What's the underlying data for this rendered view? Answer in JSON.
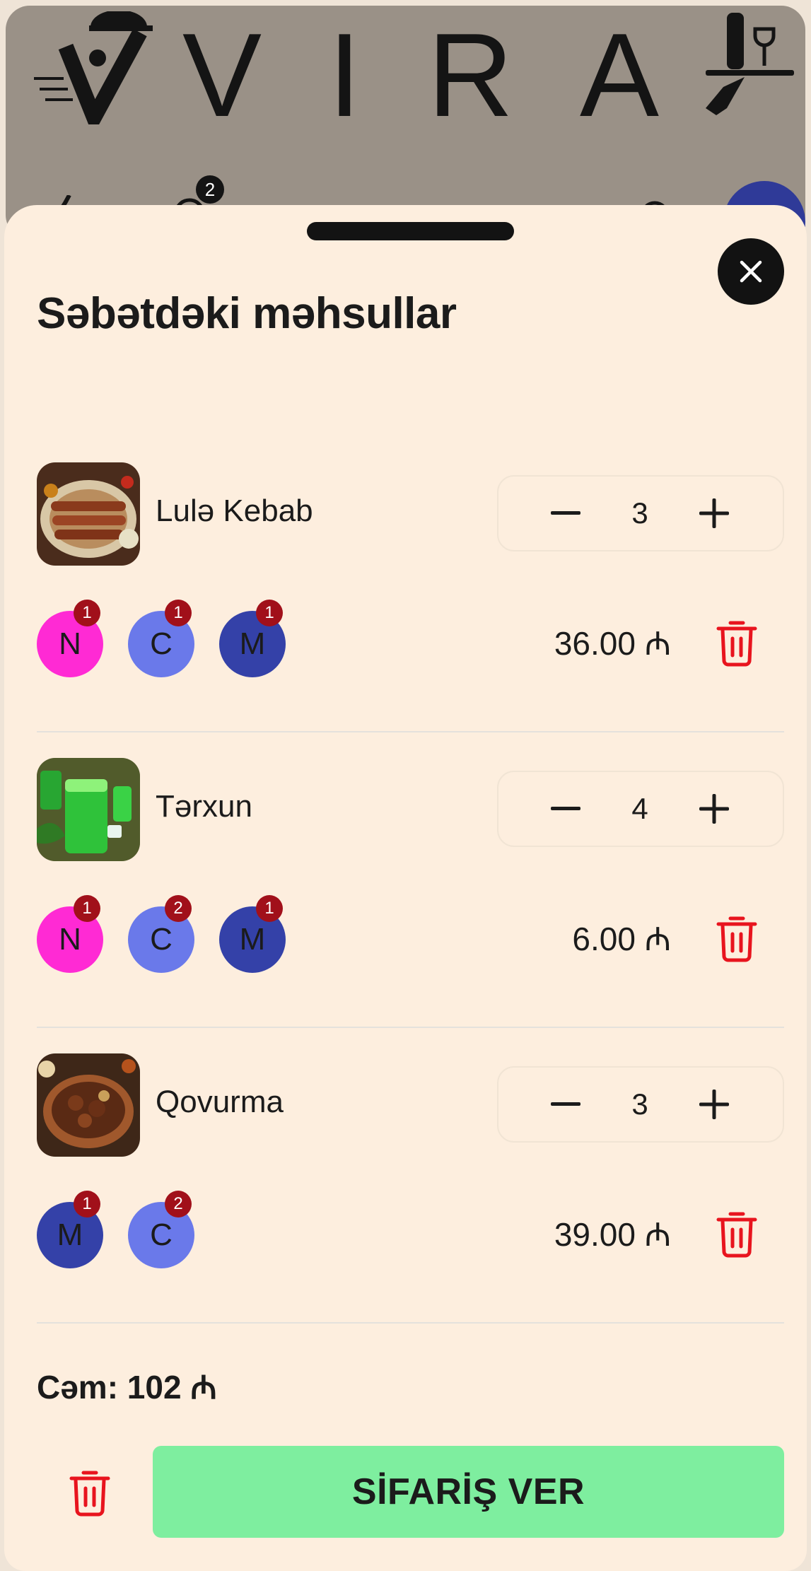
{
  "brand": {
    "letters": [
      "V",
      "I",
      "R",
      "A"
    ]
  },
  "header_peek": {
    "cart_count": "2"
  },
  "sheet": {
    "title": "Səbətdəki məhsullar"
  },
  "currency": "₼",
  "items": [
    {
      "name": "Lulə Kebab",
      "quantity": "3",
      "price": "36.00 ₼",
      "chips": [
        {
          "letter": "N",
          "count": "1",
          "color": "#ff2ad4"
        },
        {
          "letter": "C",
          "count": "1",
          "color": "#6a79ea"
        },
        {
          "letter": "M",
          "count": "1",
          "color": "#3441a8"
        }
      ]
    },
    {
      "name": "Tərxun",
      "quantity": "4",
      "price": "6.00 ₼",
      "chips": [
        {
          "letter": "N",
          "count": "1",
          "color": "#ff2ad4"
        },
        {
          "letter": "C",
          "count": "2",
          "color": "#6a79ea"
        },
        {
          "letter": "M",
          "count": "1",
          "color": "#3441a8"
        }
      ]
    },
    {
      "name": "Qovurma",
      "quantity": "3",
      "price": "39.00 ₼",
      "chips": [
        {
          "letter": "M",
          "count": "1",
          "color": "#3441a8"
        },
        {
          "letter": "C",
          "count": "2",
          "color": "#6a79ea"
        }
      ]
    }
  ],
  "total": "Cəm: 102 ₼",
  "order_button": "SİFARİŞ VER",
  "colors": {
    "accent_green": "#7eee9f",
    "delete_red": "#e8141e",
    "badge_red": "#a1101a",
    "sheet_bg": "#fdeede"
  },
  "icons": {
    "close": "close-icon",
    "minus": "minus-icon",
    "plus": "plus-icon",
    "delete": "trash-icon"
  }
}
